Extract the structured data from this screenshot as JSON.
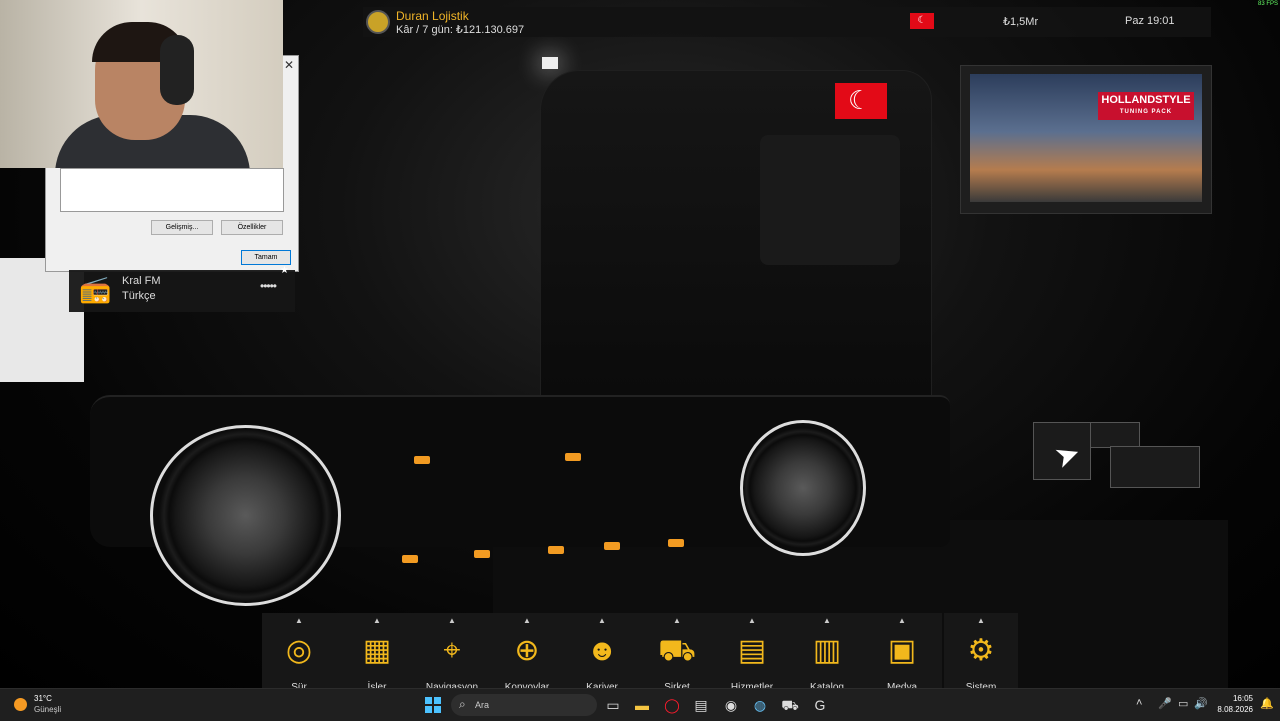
{
  "hud": {
    "company": "Duran Lojistik",
    "profit": "Kâr / 7 gün: ₺121.130.697",
    "flag_country": "Turkey",
    "money": "₺1,5Mr",
    "time": "Paz 19:01",
    "fps": "83 FPS"
  },
  "dialog": {
    "button_advanced": "Gelişmiş...",
    "button_properties": "Özellikler",
    "button_ok": "Tamam"
  },
  "radio": {
    "station": "Kral FM",
    "language": "Türkçe",
    "more": "•••••"
  },
  "ad": {
    "brand": "HOLLANDSTYLE",
    "tagline": "TUNING PACK"
  },
  "menu": {
    "items": [
      {
        "label": "Sür",
        "icon": "steering-wheel-icon"
      },
      {
        "label": "İşler",
        "icon": "cargo-icon"
      },
      {
        "label": "Navigasyon",
        "icon": "map-pin-icon"
      },
      {
        "label": "Konvoylar",
        "icon": "globe-icon"
      },
      {
        "label": "Kariyer",
        "icon": "person-icon"
      },
      {
        "label": "Şirket",
        "icon": "truck-company-icon"
      },
      {
        "label": "Hizmetler",
        "icon": "service-icon"
      },
      {
        "label": "Katalog",
        "icon": "books-icon"
      },
      {
        "label": "Medya",
        "icon": "media-icon"
      }
    ],
    "system": {
      "label": "Sistem",
      "icon": "gear-icon"
    }
  },
  "taskbar": {
    "temp": "31°C",
    "condition": "Güneşli",
    "search_placeholder": "Ara",
    "time": "16:05",
    "date": "8.08.2026"
  },
  "colors": {
    "accent": "#f2b81c",
    "company": "#f0b428",
    "flag": "#e30a17"
  }
}
